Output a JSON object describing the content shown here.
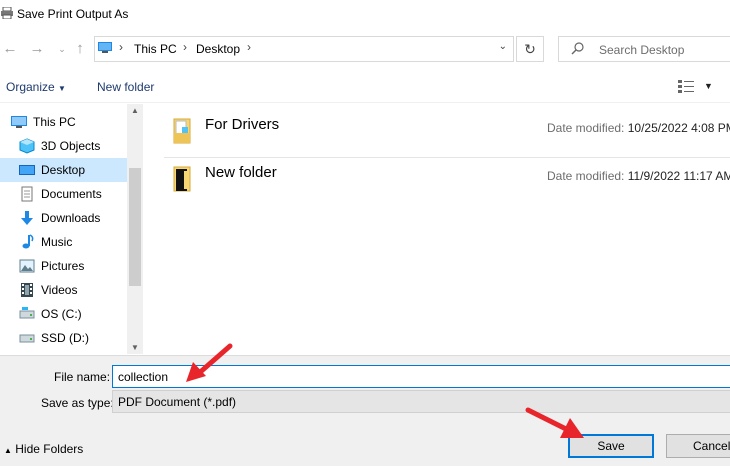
{
  "window": {
    "title": "Save Print Output As"
  },
  "nav": {
    "back_icon": "back-arrow-icon",
    "forward_icon": "forward-arrow-icon",
    "up_icon": "up-arrow-icon",
    "breadcrumb": [
      "This PC",
      "Desktop"
    ],
    "search_placeholder": "Search Desktop"
  },
  "toolbar": {
    "organize_label": "Organize",
    "new_folder_label": "New folder"
  },
  "sidebar": {
    "items": [
      {
        "label": "This PC",
        "icon": "computer-icon"
      },
      {
        "label": "3D Objects",
        "icon": "cube-icon"
      },
      {
        "label": "Desktop",
        "icon": "desktop-icon",
        "selected": true
      },
      {
        "label": "Documents",
        "icon": "documents-icon"
      },
      {
        "label": "Downloads",
        "icon": "download-icon"
      },
      {
        "label": "Music",
        "icon": "music-icon"
      },
      {
        "label": "Pictures",
        "icon": "pictures-icon"
      },
      {
        "label": "Videos",
        "icon": "videos-icon"
      },
      {
        "label": "OS (C:)",
        "icon": "drive-icon"
      },
      {
        "label": "SSD (D:)",
        "icon": "drive-icon"
      }
    ]
  },
  "files": [
    {
      "name": "For Drivers",
      "meta_label": "Date modified:",
      "date": "10/25/2022 4:08 PM"
    },
    {
      "name": "New folder",
      "meta_label": "Date modified:",
      "date": "11/9/2022 11:17 AM"
    }
  ],
  "form": {
    "file_name_label": "File name:",
    "file_name_value": "collection",
    "save_as_type_label": "Save as type:",
    "save_as_type_value": "PDF Document (*.pdf)"
  },
  "footer": {
    "hide_folders_label": "Hide Folders",
    "save_label": "Save",
    "cancel_label": "Cancel"
  },
  "colors": {
    "accent": "#0078d7",
    "selection": "#cce8ff",
    "annotation_arrow": "#e8252b"
  }
}
